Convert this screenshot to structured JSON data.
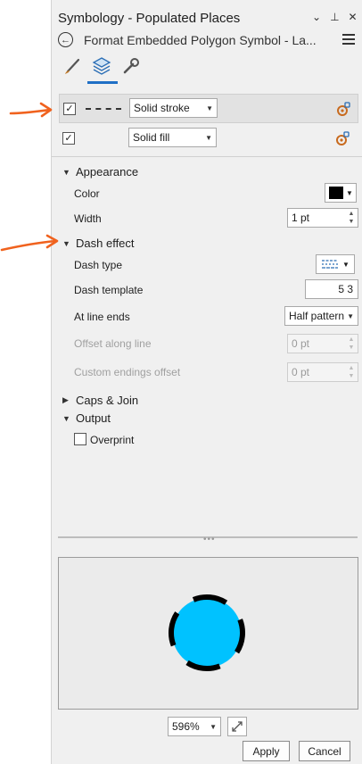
{
  "panel": {
    "title": "Symbology - Populated Places",
    "title_controls": {
      "menu": "⌄",
      "pin": "⊥",
      "close": "✕"
    },
    "subtitle": "Format Embedded Polygon Symbol - La..."
  },
  "tool_tabs": [
    {
      "name": "properties-brush",
      "active": false
    },
    {
      "name": "layers",
      "active": true
    },
    {
      "name": "structure-wrench",
      "active": false
    }
  ],
  "symbol_layers": [
    {
      "checked": true,
      "type_value": "Solid stroke",
      "has_dash_preview": true,
      "selected": true
    },
    {
      "checked": true,
      "type_value": "Solid fill",
      "has_dash_preview": false,
      "selected": false
    }
  ],
  "sections": {
    "appearance": {
      "heading": "Appearance",
      "color_label": "Color",
      "color_value": "#000000",
      "width_label": "Width",
      "width_value": "1 pt"
    },
    "dash_effect": {
      "heading": "Dash effect",
      "dash_type_label": "Dash type",
      "dash_template_label": "Dash template",
      "dash_template_value": "5 3",
      "line_ends_label": "At line ends",
      "line_ends_value": "Half pattern",
      "offset_label": "Offset along line",
      "offset_value": "0 pt",
      "custom_offset_label": "Custom endings offset",
      "custom_offset_value": "0 pt"
    },
    "caps_join": {
      "heading": "Caps & Join"
    },
    "output": {
      "heading": "Output",
      "overprint_label": "Overprint",
      "overprint_checked": false
    }
  },
  "preview": {
    "fill_color": "#00c2ff",
    "stroke_color": "#000000",
    "background": "#ebebeb",
    "zoom_value": "596%"
  },
  "footer": {
    "apply_label": "Apply",
    "cancel_label": "Cancel"
  },
  "annotation_color": "#f0621e"
}
